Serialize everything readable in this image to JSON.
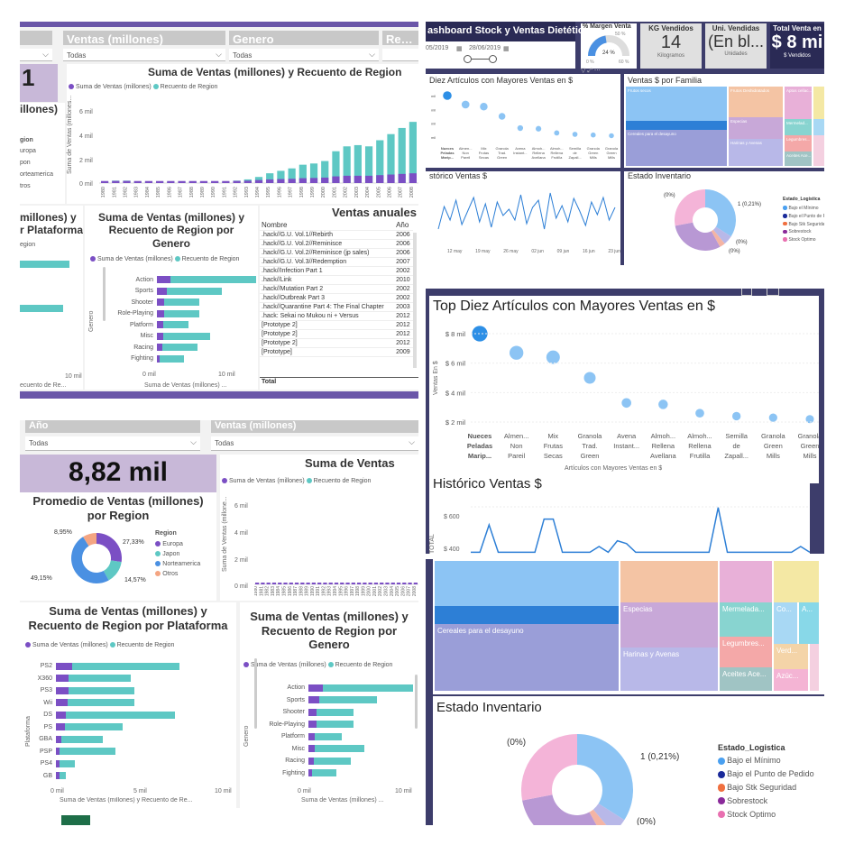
{
  "q1": {
    "filters": {
      "ventas_header": "Ventas (millones)",
      "genero_header": "Genero",
      "region_header": "Region",
      "ventas_value": "Todas",
      "genero_value": "Todas"
    },
    "kpi_fragment": "1",
    "region_title_fragment": "illones)",
    "region_legend_title": "gion",
    "region_legend": [
      "uropa",
      "pon",
      "orteamerica",
      "tros"
    ],
    "main_chart_title": "Suma de Ventas (millones) y Recuento de Region",
    "legend": [
      "Suma de Ventas (millones)",
      "Recuento de Region"
    ],
    "ylabel": "Suma de Ventas (millones...",
    "ytick": [
      "6 mil",
      "4 mil",
      "2 mil",
      "0 mil"
    ],
    "plat_title_fragment": "millones) y",
    "plat_title_fragment2": "r Plataforma",
    "plat_legend_fragment": "egion",
    "plat_axis_fragment": "ecuento de Re...",
    "plat_tick": "10 mil",
    "genre_title": "Suma de Ventas (millones) y Recuento de Region por Genero",
    "genre_ylabel": "Genero",
    "genre_xlabel": "Suma de Ventas (millones) ...",
    "genre_xticks": [
      "0 mil",
      "10 mil"
    ],
    "table_title": "Ventas anuales",
    "table_headers": [
      "Nombre",
      "Año"
    ],
    "table_rows": [
      [
        ".hack//G.U. Vol.1//Rebirth",
        "2006"
      ],
      [
        ".hack//G.U. Vol.2//Reminisce",
        "2006"
      ],
      [
        ".hack//G.U. Vol.2//Reminisce (jp sales)",
        "2006"
      ],
      [
        ".hack//G.U. Vol.3//Redemption",
        "2007"
      ],
      [
        ".hack//Infection Part 1",
        "2002"
      ],
      [
        ".hack//Link",
        "2010"
      ],
      [
        ".hack//Mutation Part 2",
        "2002"
      ],
      [
        ".hack//Outbreak Part 3",
        "2002"
      ],
      [
        ".hack//Quarantine Part 4: The Final Chapter",
        "2003"
      ],
      [
        ".hack: Sekai no Mukou ni + Versus",
        "2012"
      ],
      [
        "[Prototype 2]",
        "2012"
      ],
      [
        "[Prototype 2]",
        "2012"
      ],
      [
        "[Prototype 2]",
        "2012"
      ],
      [
        "[Prototype]",
        "2009"
      ]
    ],
    "table_total": "Total"
  },
  "q2": {
    "title": "ashboard Stock y Ventas Dietética",
    "date_from": "05/2019",
    "date_to": "28/06/2019",
    "gauge_label": "% Margen Venta",
    "gauge_value": "24 %",
    "gauge_max": "50 %",
    "gauge_min": "0 %",
    "gauge_right": "60 %",
    "kg_label": "KG Vendidos",
    "kg_value": "14",
    "kg_unit": "Kilogramos",
    "uni_label": "Uni. Vendidas",
    "uni_value": "(En bl...",
    "uni_unit": "Unidades",
    "total_label": "Total Venta en",
    "total_value": "$ 8 mi",
    "total_unit": "$ Vendidos",
    "top10_title": "Diez Artículos con Mayores Ventas en $",
    "top10_ticks": [
      "mil",
      "mil",
      "mil",
      "mil"
    ],
    "fam_title": "Ventas $ por Familia",
    "hist_title": "stórico Ventas $",
    "inv_title": "Estado Inventario",
    "inv_pct_a": "(0%)",
    "inv_pct_b": "1 (0,21%)",
    "inv_pct_c": "(0%)",
    "inv_pct_d": "(0%)",
    "inv_legend_title": "Estado_Logistica",
    "inv_legend": [
      "Bajo el Mínimo",
      "Bajo el Punto de Pe",
      "Bajo Stk Seguridad",
      "Sobrestock",
      "Stock Optimo"
    ],
    "hist_x": [
      "12 may",
      "19 may",
      "26 may",
      "02 jun",
      "09 jun",
      "16 jun",
      "23 jun"
    ],
    "fam_labels": [
      "Frutos secos",
      "Cereales para el desayuno",
      "Frutos Deshidratados",
      "Especias",
      "Harinas y Avenas",
      "Aptos celíac...",
      "Mermelad...",
      "Legumbres...",
      "Aceites Ace..."
    ]
  },
  "q3": {
    "filters": {
      "anio_header": "Año",
      "ventas_header": "Ventas (millones)",
      "anio_value": "Todas",
      "ventas_value": "Todas"
    },
    "kpi": "8,82 mil",
    "donut_title": "Promedio de Ventas (millones) por Region",
    "donut_legend_title": "Region",
    "donut_legend": [
      "Europa",
      "Japon",
      "Norteamerica",
      "Otros"
    ],
    "donut_pcts": [
      "8,95%",
      "27,33%",
      "14,57%",
      "49,15%"
    ],
    "main_title": "Suma de Ventas",
    "legend": [
      "Suma de Ventas (millones)",
      "Recuento de Region"
    ],
    "ylabel": "Suma de Ventas (millone...",
    "yticks": [
      "6 mil",
      "4 mil",
      "2 mil",
      "0 mil"
    ],
    "plat_title": "Suma de Ventas (millones) y Recuento de Region por Plataforma",
    "plat_ylabel": "Plataforma",
    "plat_xlabel": "Suma de Ventas (millones) y Recuento de Re...",
    "plat_xticks": [
      "0 mil",
      "5 mil",
      "10 mil"
    ],
    "genre_title": "Suma de Ventas (millones) y Recuento de Region por Genero",
    "genre_ylabel": "Genero",
    "genre_xlabel": "Suma de Ventas (millones) ...",
    "genre_xticks": [
      "0 mil",
      "10 mil"
    ]
  },
  "q4": {
    "top10_title": "Top Diez Artículos con Mayores Ventas en $",
    "ylabel": "Ventas En $",
    "yticks": [
      "$ 8 mil",
      "$ 6 mil",
      "$ 4 mil",
      "$ 2 mil"
    ],
    "xlabel": "Artículos con Mayores Ventas en $",
    "hist_title": "Histórico Ventas $",
    "hist_yticks": [
      "$ 600",
      "$ 400"
    ],
    "hist_ylabel": "TOTAL"
  },
  "q5": {
    "fam_labels": [
      "Cereales para el desayuno",
      "Especias",
      "Harinas y Avenas",
      "Mermelada...",
      "Legumbres...",
      "Aceites Ace...",
      "Co...",
      "A...",
      "Verd...",
      "Azúc..."
    ],
    "inv_title": "Estado Inventario",
    "inv_pct_a": "(0%)",
    "inv_pct_b": "1 (0,21%)",
    "inv_pct_c": "(0%)",
    "inv_legend_title": "Estado_Logistica",
    "inv_legend": [
      "Bajo el Mínimo",
      "Bajo el Punto de Pedido",
      "Bajo Stk Seguridad",
      "Sobrestock",
      "Stock Optimo"
    ]
  },
  "colors": {
    "purple": "#7b4fc4",
    "teal": "#5ec8c4",
    "blue": "#4a90e2",
    "orange": "#f4a582",
    "navy": "#3d3d6b",
    "lav": "#c8b8d8",
    "pink": "#e8a0c8",
    "lightblue": "#8cc4f4"
  },
  "chart_data": [
    {
      "type": "bar",
      "title": "Suma de Ventas (millones) y Recuento de Region por Plataforma",
      "categories": [
        "PS2",
        "X360",
        "PS3",
        "Wii",
        "DS",
        "PS",
        "GBA",
        "PSP",
        "PS4",
        "GB"
      ],
      "series": [
        {
          "name": "Suma de Ventas (millones)",
          "values": [
            1.3,
            1.0,
            1.0,
            0.9,
            0.8,
            0.7,
            0.4,
            0.3,
            0.3,
            0.3
          ]
        },
        {
          "name": "Recuento de Region",
          "values": [
            8.5,
            4.9,
            5.2,
            5.3,
            8.6,
            4.6,
            3.3,
            4.4,
            1.2,
            0.5
          ]
        }
      ],
      "xlim": [
        0,
        12
      ]
    },
    {
      "type": "bar",
      "title": "Suma de Ventas (millones) y Recuento de Region por Genero",
      "categories": [
        "Action",
        "Sports",
        "Shooter",
        "Role-Playing",
        "Platform",
        "Misc",
        "Racing",
        "Fighting"
      ],
      "series": [
        {
          "name": "Suma de Ventas (millones)",
          "values": [
            1.8,
            1.3,
            1.0,
            1.0,
            0.8,
            0.8,
            0.7,
            0.4
          ]
        },
        {
          "name": "Recuento de Region",
          "values": [
            11.2,
            7.2,
            4.6,
            4.6,
            3.3,
            6.2,
            4.6,
            3.1
          ]
        }
      ],
      "xlim": [
        0,
        13
      ]
    },
    {
      "type": "pie",
      "title": "Promedio de Ventas (millones) por Region",
      "categories": [
        "Europa",
        "Japon",
        "Norteamerica",
        "Otros"
      ],
      "values": [
        27.33,
        14.57,
        49.15,
        8.95
      ]
    },
    {
      "type": "scatter",
      "title": "Top Diez Artículos con Mayores Ventas en $",
      "categories": [
        "Nueces Peladas Marip...",
        "Almen... Non Pareil",
        "Mix Frutas Secas ...",
        "Granola Trad. Green ...",
        "Avena Instant...",
        "Almoh... Rellena Avellana",
        "Almoh... Rellena Frutilla",
        "Semilla de Zapall...",
        "Granola Green Mills C...",
        "Granola Green Mills F..."
      ],
      "values": [
        8.0,
        6.7,
        6.4,
        5.0,
        3.3,
        3.2,
        2.6,
        2.4,
        2.3,
        2.2
      ],
      "ylabel": "Ventas En $",
      "xlabel": "Artículos con Mayores Ventas en $"
    },
    {
      "type": "bar",
      "title": "Suma de Ventas (millones) y Recuento de Region",
      "categories": [
        "1980",
        "1981",
        "1982",
        "1983",
        "1984",
        "1985",
        "1986",
        "1987",
        "1988",
        "1989",
        "1990",
        "1991",
        "1992",
        "1993",
        "1994",
        "1995",
        "1996",
        "1997",
        "1998",
        "1999",
        "2000",
        "2001",
        "2002",
        "2003",
        "2004",
        "2005",
        "2006",
        "2007",
        "2008"
      ],
      "series": [
        {
          "name": "Recuento de Region",
          "values": [
            0.1,
            0.2,
            0.2,
            0.1,
            0.1,
            0.1,
            0.1,
            0.1,
            0.1,
            0.1,
            0.1,
            0.1,
            0.2,
            0.3,
            0.5,
            0.8,
            1.0,
            1.2,
            1.5,
            1.6,
            1.8,
            2.6,
            3.0,
            3.1,
            3.0,
            3.5,
            4.0,
            4.5,
            5.0
          ]
        },
        {
          "name": "Suma de Ventas (millones)",
          "values": [
            0.02,
            0.03,
            0.03,
            0.02,
            0.02,
            0.02,
            0.02,
            0.02,
            0.02,
            0.02,
            0.02,
            0.02,
            0.03,
            0.05,
            0.1,
            0.15,
            0.18,
            0.2,
            0.25,
            0.27,
            0.3,
            0.4,
            0.45,
            0.45,
            0.45,
            0.5,
            0.55,
            0.6,
            0.65
          ]
        }
      ],
      "ylim": [
        0,
        7
      ]
    }
  ]
}
